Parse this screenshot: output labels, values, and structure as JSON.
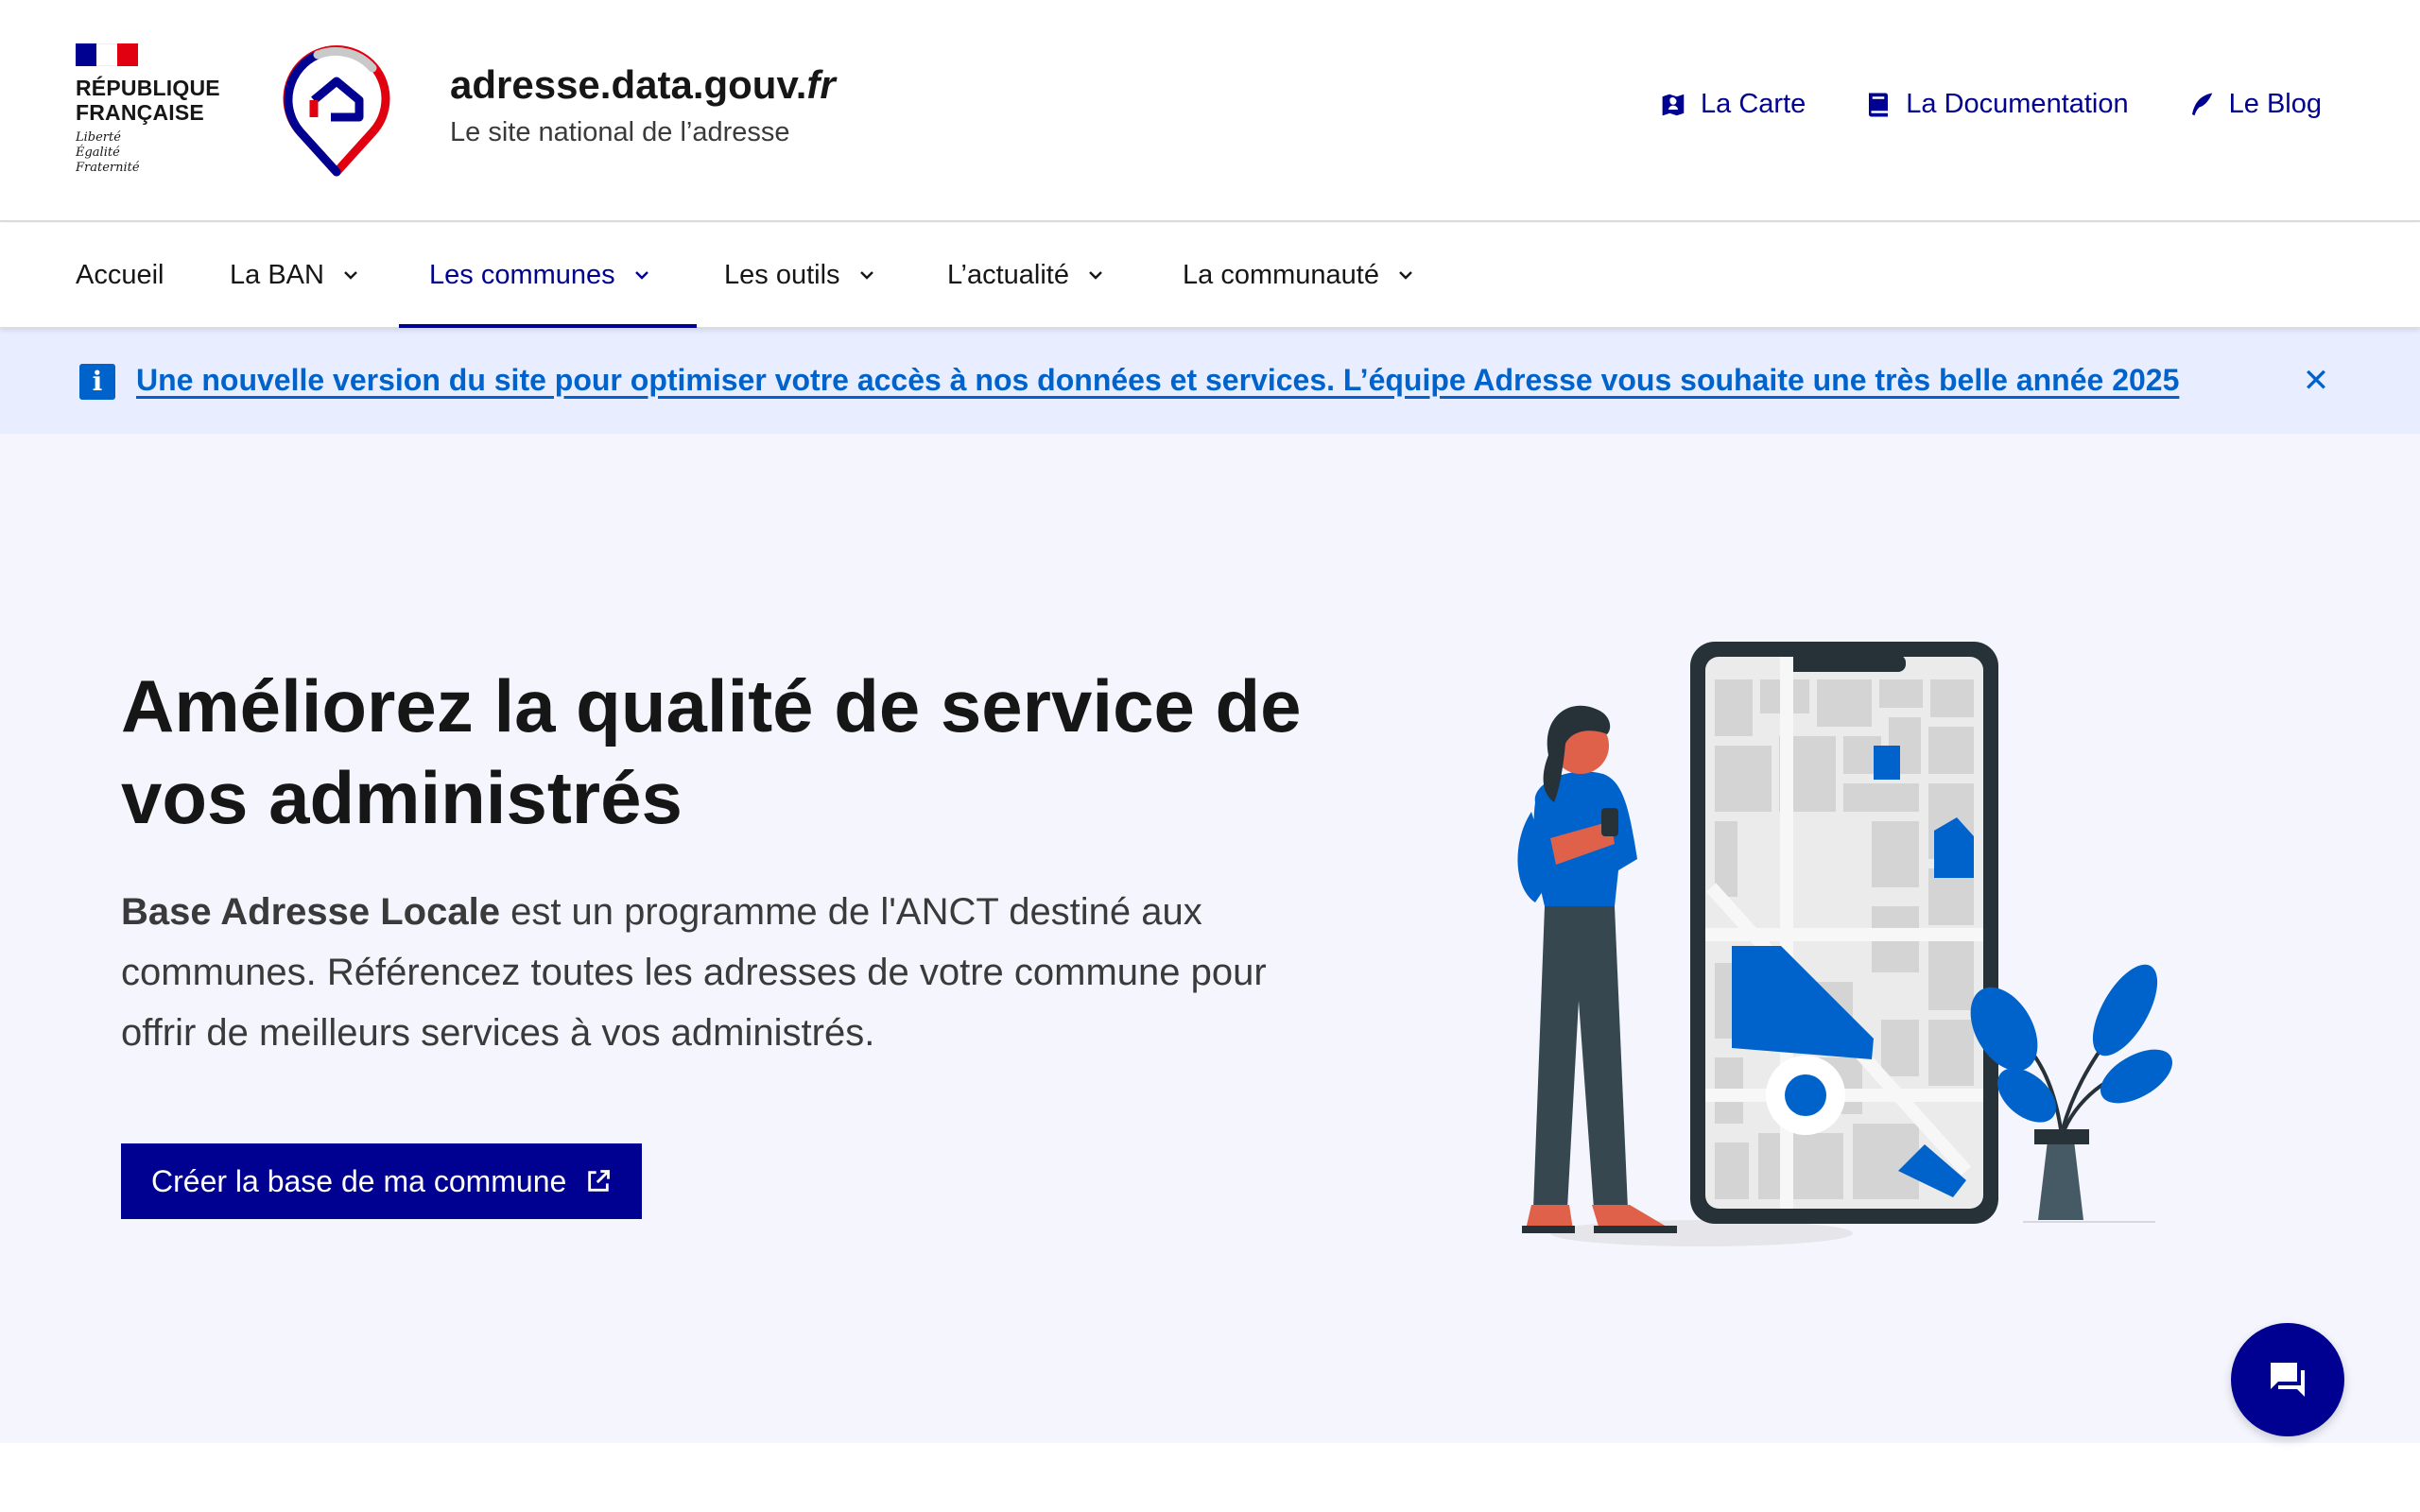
{
  "brand": {
    "republique_line1": "RÉPUBLIQUE",
    "republique_line2": "FRANÇAISE",
    "devise": [
      "Liberté",
      "Égalité",
      "Fraternité"
    ],
    "site_name_main": "adresse.data.gouv.",
    "site_name_tld": "fr",
    "tagline": "Le site national de l’adresse"
  },
  "quick_links": [
    {
      "label": "La Carte",
      "icon": "map-icon"
    },
    {
      "label": "La Documentation",
      "icon": "book-icon"
    },
    {
      "label": "Le Blog",
      "icon": "quill-icon"
    }
  ],
  "nav": {
    "items": [
      {
        "label": "Accueil",
        "dropdown": false
      },
      {
        "label": "La BAN",
        "dropdown": true
      },
      {
        "label": "Les communes",
        "dropdown": true,
        "active": true
      },
      {
        "label": "Les outils",
        "dropdown": true
      },
      {
        "label": "L’actualité",
        "dropdown": true
      },
      {
        "label": "La communauté",
        "dropdown": true
      }
    ]
  },
  "notice": {
    "text": "Une nouvelle version du site pour optimiser votre accès à nos données et services. L’équipe Adresse vous souhaite une très belle année 2025",
    "icon": "info-icon",
    "close_icon": "close-icon"
  },
  "hero": {
    "title": "Améliorez la qualité de service de vos administrés",
    "desc_bold": "Base Adresse Locale",
    "desc_rest": " est un programme de l'ANCT destiné aux communes. Référencez toutes les adresses de votre commune pour offrir de meilleurs services à vos administrés.",
    "cta_label": "Créer la base de ma commune",
    "cta_icon": "external-link-icon"
  },
  "chat": {
    "icon": "chat-icon"
  },
  "colors": {
    "primary": "#000091",
    "info": "#0063cb",
    "notice_bg": "#e8edff",
    "hero_bg": "#f5f5fe",
    "flag_blue": "#000091",
    "flag_red": "#e1000f"
  }
}
